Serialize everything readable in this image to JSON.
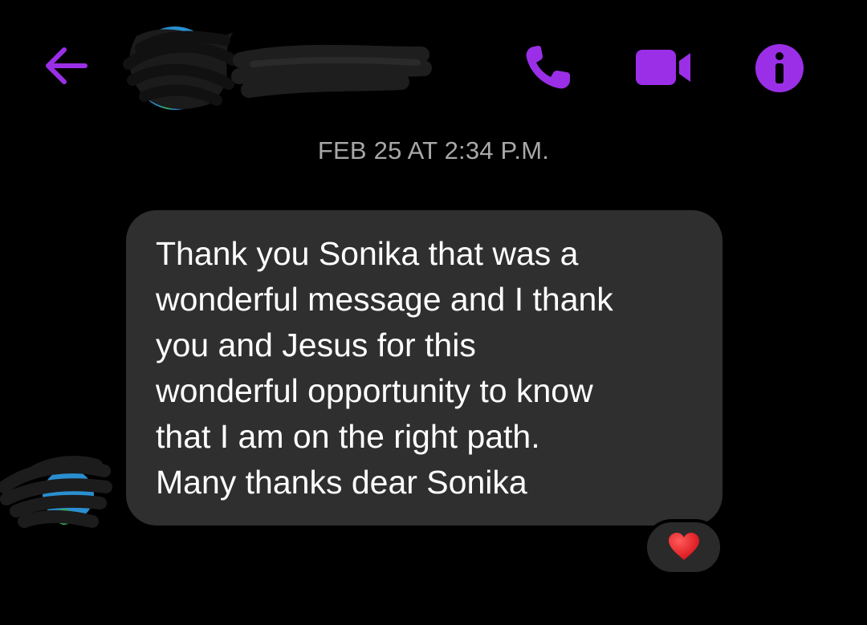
{
  "header": {
    "back_icon": "arrow-left-icon",
    "contact_name_redacted": true,
    "call_icon": "phone-icon",
    "video_icon": "video-camera-icon",
    "info_icon": "info-icon",
    "accent_color": "#9b2fe8"
  },
  "conversation": {
    "timestamp": "FEB 25 AT 2:34 P.M.",
    "message": {
      "text": "Thank you Sonika that was a\nwonderful message and I thank\nyou and Jesus for this\nwonderful opportunity to know\nthat I am on the right path.\nMany thanks dear Sonika",
      "bubble_color": "#2f2f2f",
      "reaction_icon": "red-heart-icon"
    }
  }
}
